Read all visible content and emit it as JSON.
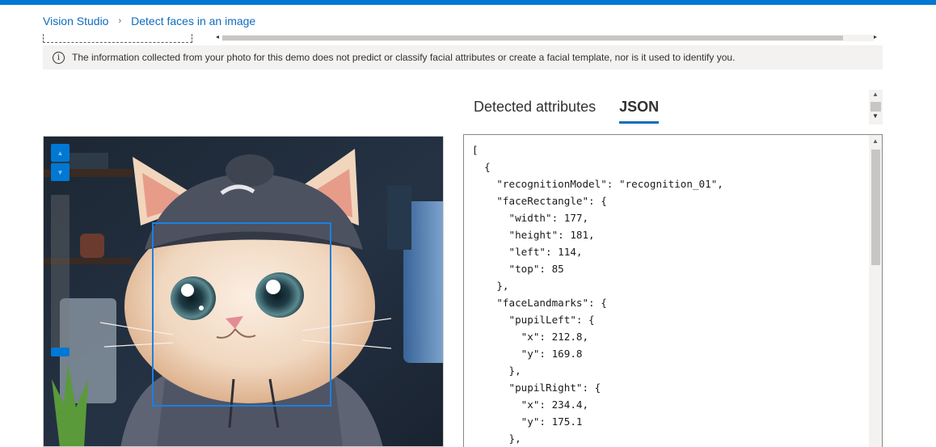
{
  "breadcrumb": {
    "root": "Vision Studio",
    "separator": "›",
    "current": "Detect faces in an image"
  },
  "info": {
    "icon": "info-icon",
    "icon_glyph": "i",
    "text": "The information collected from your photo for this demo does not predict or classify facial attributes or create a facial template, nor is it used to identify you."
  },
  "image_viewer": {
    "zoom_in_icon": "▲",
    "zoom_out_icon": "▼",
    "zoom_level": 0.05
  },
  "tabs": [
    {
      "label": "Detected attributes",
      "active": false
    },
    {
      "label": "JSON",
      "active": true
    }
  ],
  "json_output": "[\n  {\n    \"recognitionModel\": \"recognition_01\",\n    \"faceRectangle\": {\n      \"width\": 177,\n      \"height\": 181,\n      \"left\": 114,\n      \"top\": 85\n    },\n    \"faceLandmarks\": {\n      \"pupilLeft\": {\n        \"x\": 212.8,\n        \"y\": 169.8\n      },\n      \"pupilRight\": {\n        \"x\": 234.4,\n        \"y\": 175.1\n      },",
  "colors": {
    "accent": "#0078d4",
    "link": "#0f6cbd",
    "face_box": "#1d7fe0"
  }
}
